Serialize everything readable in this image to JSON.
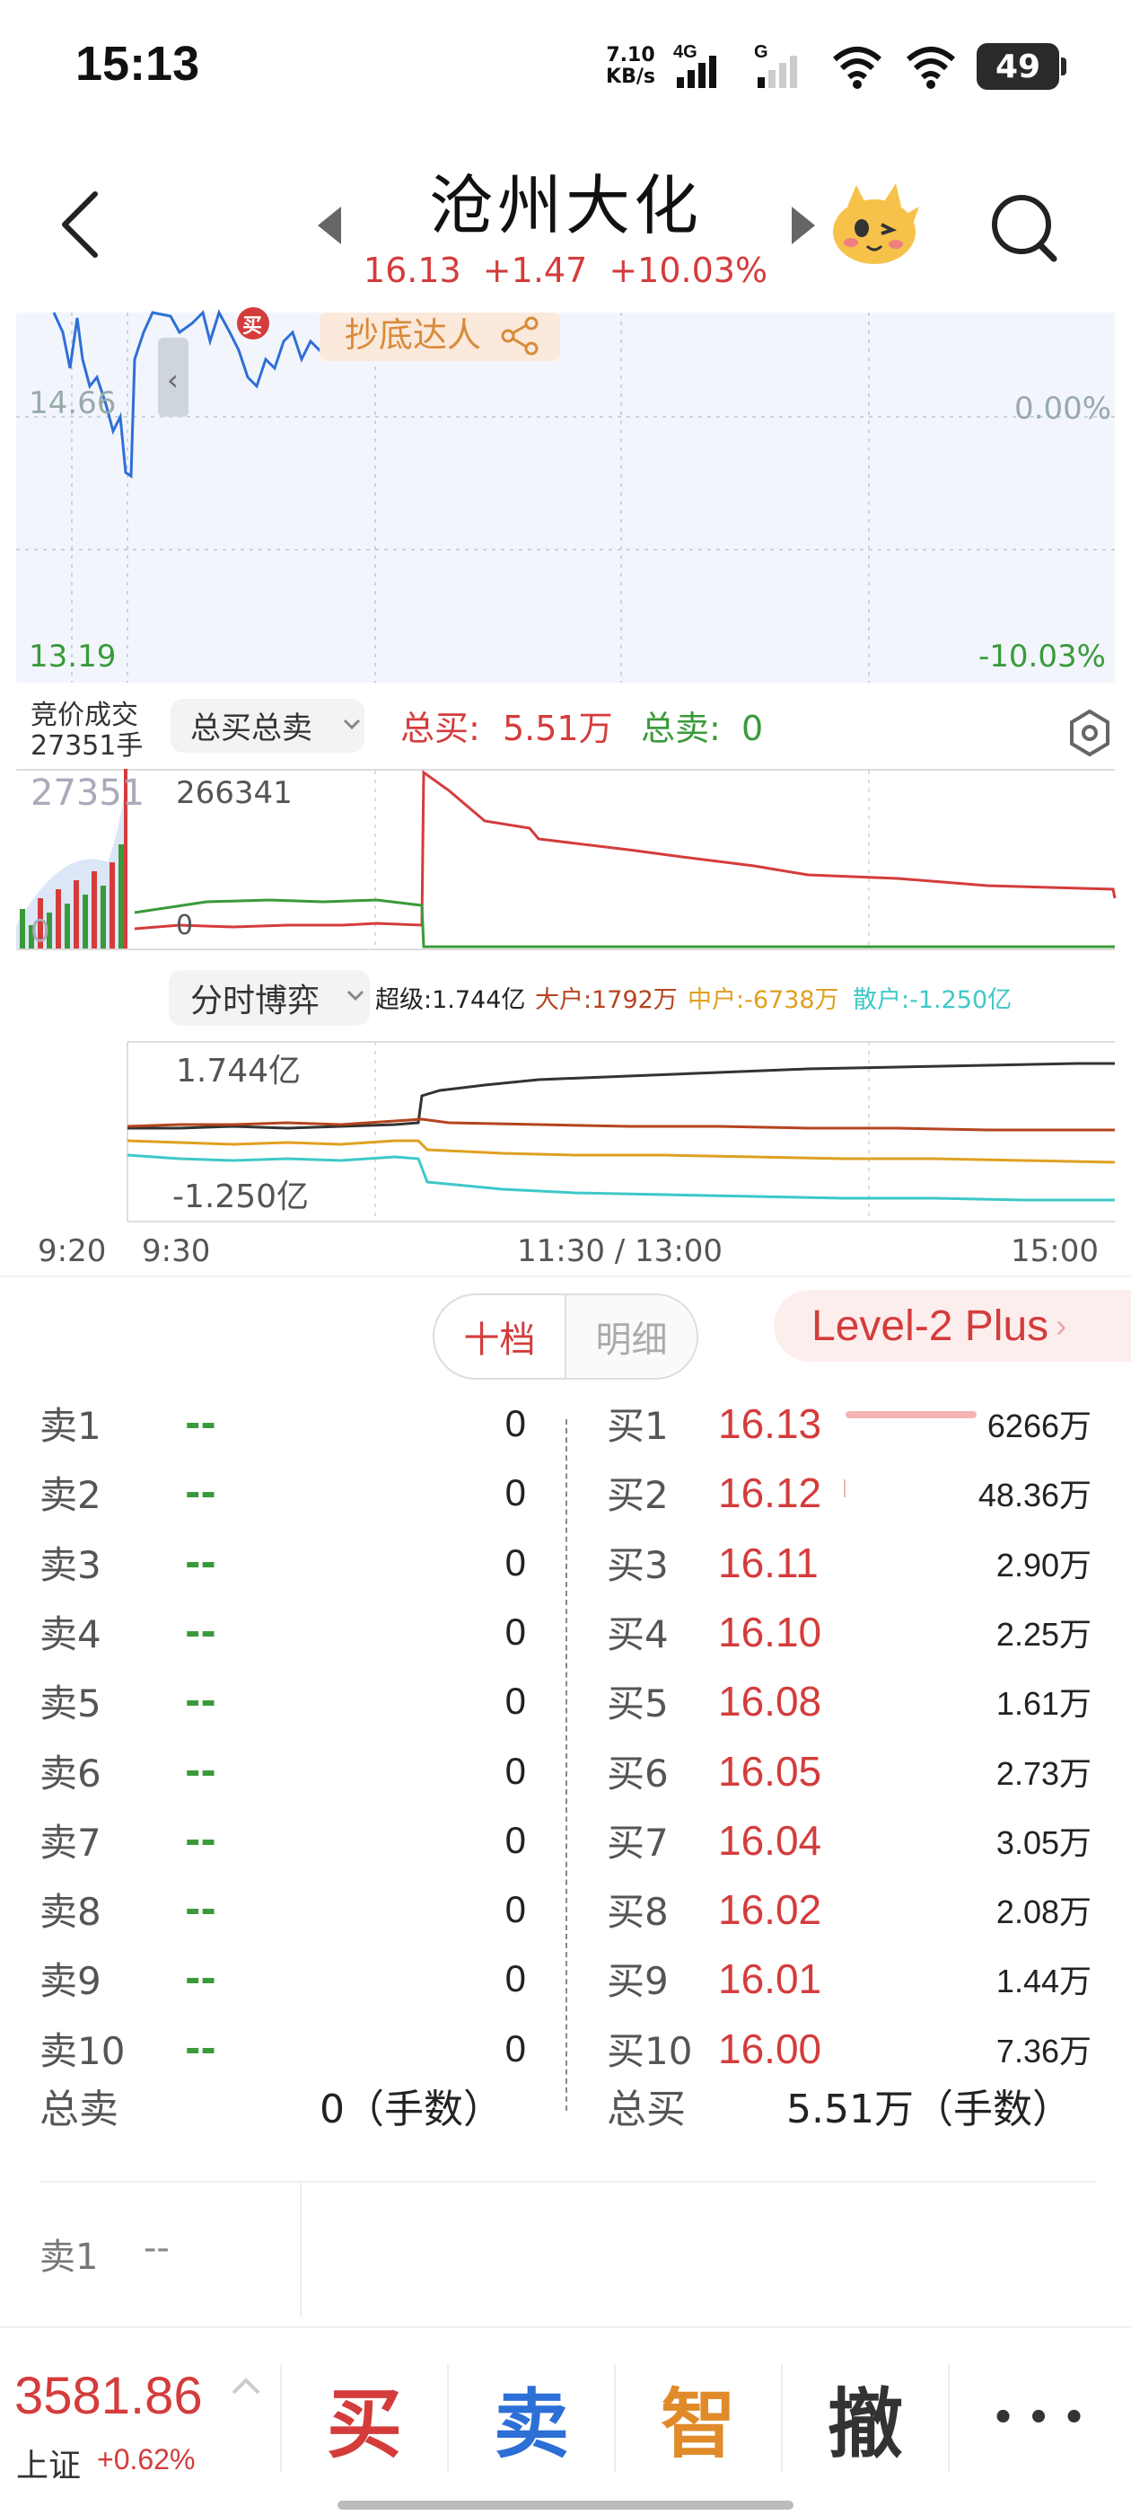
{
  "status_bar": {
    "time": "15:13",
    "net_speed_value": "7.10",
    "net_speed_unit": "KB/s",
    "signal_1": "4G",
    "signal_2": "G",
    "battery": "49"
  },
  "header": {
    "stock_name": "沧州大化",
    "price": "16.13",
    "change": "+1.47",
    "change_pct": "+10.03%",
    "icons": [
      "back-icon",
      "prev-arrow-icon",
      "next-arrow-icon",
      "mascot-icon",
      "search-icon"
    ]
  },
  "intraday": {
    "price_low_label": "13.19",
    "price_mid_label": "14.66",
    "pct_mid_label": "0.00%",
    "pct_low_label": "-10.03%",
    "badge_text": "抄底达人",
    "buy_marker": "买",
    "collapse_arrow": "‹"
  },
  "auction": {
    "label_line1": "竞价成交",
    "label_line2": "27351手",
    "selector": "总买总卖",
    "total_buy_label": "总买:",
    "total_buy_value": "5.51万",
    "total_sell_label": "总卖:",
    "total_sell_value": "0",
    "vol_left": "27351",
    "vol_left_zero": "0",
    "vol_mid": "266341",
    "vol_mid_zero": "0"
  },
  "game": {
    "selector": "分时博弈",
    "super_label": "超级:1.744亿",
    "large_label": "大户:1792万",
    "mid_label": "中户:-6738万",
    "retail_label": "散户:-1.250亿",
    "axis_top": "1.744亿",
    "axis_bottom": "-1.250亿",
    "colors": {
      "super": "#333333",
      "large": "#b5441f",
      "mid": "#e0a020",
      "retail": "#3ec8c8"
    }
  },
  "time_axis": {
    "t0": "9:20",
    "t1": "9:30",
    "t2": "11:30 / 13:00",
    "t3": "15:00"
  },
  "tabs": {
    "active": "十档",
    "inactive": "明细",
    "level2": "Level-2 Plus"
  },
  "order_book": {
    "sells": [
      {
        "label": "卖1",
        "price": "--",
        "vol": "0"
      },
      {
        "label": "卖2",
        "price": "--",
        "vol": "0"
      },
      {
        "label": "卖3",
        "price": "--",
        "vol": "0"
      },
      {
        "label": "卖4",
        "price": "--",
        "vol": "0"
      },
      {
        "label": "卖5",
        "price": "--",
        "vol": "0"
      },
      {
        "label": "卖6",
        "price": "--",
        "vol": "0"
      },
      {
        "label": "卖7",
        "price": "--",
        "vol": "0"
      },
      {
        "label": "卖8",
        "price": "--",
        "vol": "0"
      },
      {
        "label": "卖9",
        "price": "--",
        "vol": "0"
      },
      {
        "label": "卖10",
        "price": "--",
        "vol": "0"
      }
    ],
    "buys": [
      {
        "label": "买1",
        "price": "16.13",
        "vol": "6266万"
      },
      {
        "label": "买2",
        "price": "16.12",
        "vol": "48.36万"
      },
      {
        "label": "买3",
        "price": "16.11",
        "vol": "2.90万"
      },
      {
        "label": "买4",
        "price": "16.10",
        "vol": "2.25万"
      },
      {
        "label": "买5",
        "price": "16.08",
        "vol": "1.61万"
      },
      {
        "label": "买6",
        "price": "16.05",
        "vol": "2.73万"
      },
      {
        "label": "买7",
        "price": "16.04",
        "vol": "3.05万"
      },
      {
        "label": "买8",
        "price": "16.02",
        "vol": "2.08万"
      },
      {
        "label": "买9",
        "price": "16.01",
        "vol": "1.44万"
      },
      {
        "label": "买10",
        "price": "16.00",
        "vol": "7.36万"
      }
    ],
    "total_sell_label": "总卖",
    "total_sell_value": "0（手数）",
    "total_buy_label": "总买",
    "total_buy_value": "5.51万（手数）"
  },
  "detail": {
    "label": "卖1",
    "value": "--"
  },
  "bottom": {
    "index_value": "3581.86",
    "index_name": "上证",
    "index_change": "+0.62%",
    "buy": "买",
    "sell": "卖",
    "smart": "智",
    "cancel": "撤",
    "more": "• • •",
    "colors": {
      "buy": "#d43c3c",
      "sell": "#2c6fd6",
      "smart": "#e08a2a",
      "cancel": "#333333"
    }
  }
}
